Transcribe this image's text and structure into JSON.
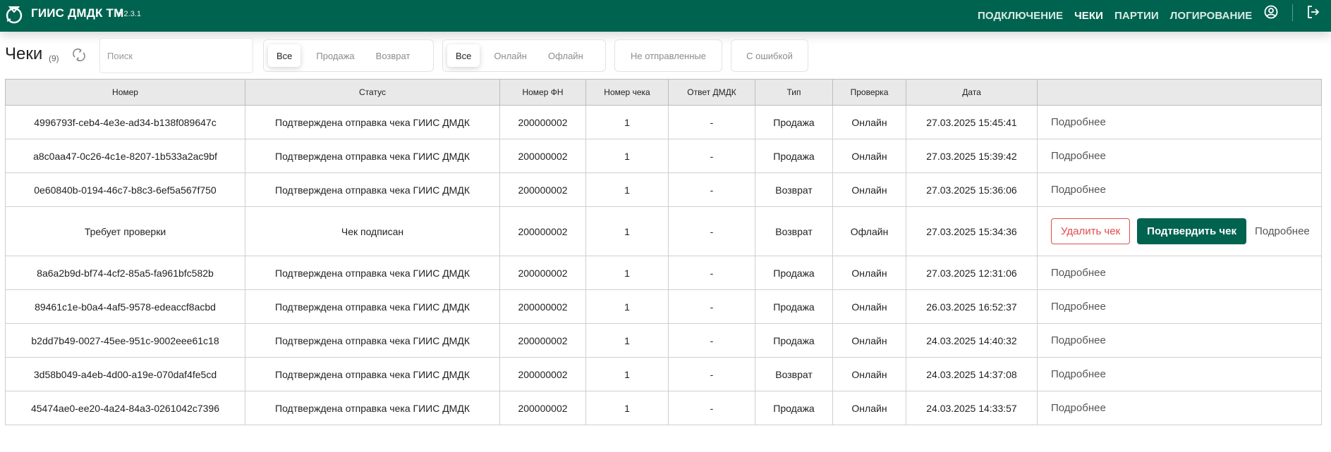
{
  "header": {
    "title": "ГИИС ДМДК ТМ",
    "version": "v 2.3.1",
    "nav": [
      {
        "label": "ПОДКЛЮЧЕНИЕ",
        "active": false
      },
      {
        "label": "ЧЕКИ",
        "active": true
      },
      {
        "label": "ПАРТИИ",
        "active": false
      },
      {
        "label": "ЛОГИРОВАНИЕ",
        "active": false
      }
    ],
    "icons": {
      "logo": "ring-logo-icon",
      "user": "user-circle-icon",
      "logout": "logout-icon"
    }
  },
  "toolbar": {
    "title": "Чеки",
    "count": "(9)",
    "search_placeholder": "Поиск",
    "type_filter": [
      "Все",
      "Продажа",
      "Возврат"
    ],
    "mode_filter": [
      "Все",
      "Онлайн",
      "Офлайн"
    ],
    "unsent_label": "Не отправленные",
    "error_label": "С ошибкой"
  },
  "table": {
    "columns": [
      "Номер",
      "Статус",
      "Номер ФН",
      "Номер чека",
      "Ответ ДМДК",
      "Тип",
      "Проверка",
      "Дата",
      ""
    ],
    "more_label": "Подробнее",
    "delete_label": "Удалить чек",
    "confirm_label": "Подтвердить чек",
    "rows": [
      {
        "id": "4996793f-ceb4-4e3e-ad34-b138f089647c",
        "status": "Подтверждена отправка чека ГИИС ДМДК",
        "fn": "200000002",
        "num": "1",
        "resp": "-",
        "type": "Продажа",
        "check": "Онлайн",
        "date": "27.03.2025 15:45:41"
      },
      {
        "id": "a8c0aa47-0c26-4c1e-8207-1b533a2ac9bf",
        "status": "Подтверждена отправка чека ГИИС ДМДК",
        "fn": "200000002",
        "num": "1",
        "resp": "-",
        "type": "Продажа",
        "check": "Онлайн",
        "date": "27.03.2025 15:39:42"
      },
      {
        "id": "0e60840b-0194-46c7-b8c3-6ef5a567f750",
        "status": "Подтверждена отправка чека ГИИС ДМДК",
        "fn": "200000002",
        "num": "1",
        "resp": "-",
        "type": "Возврат",
        "check": "Онлайн",
        "date": "27.03.2025 15:36:06"
      },
      {
        "id": "Требует проверки",
        "status": "Чек подписан",
        "fn": "200000002",
        "num": "1",
        "resp": "-",
        "type": "Возврат",
        "check": "Офлайн",
        "date": "27.03.2025 15:34:36"
      },
      {
        "id": "8a6a2b9d-bf74-4cf2-85a5-fa961bfc582b",
        "status": "Подтверждена отправка чека ГИИС ДМДК",
        "fn": "200000002",
        "num": "1",
        "resp": "-",
        "type": "Продажа",
        "check": "Онлайн",
        "date": "27.03.2025 12:31:06"
      },
      {
        "id": "89461c1e-b0a4-4af5-9578-edeaccf8acbd",
        "status": "Подтверждена отправка чека ГИИС ДМДК",
        "fn": "200000002",
        "num": "1",
        "resp": "-",
        "type": "Продажа",
        "check": "Онлайн",
        "date": "26.03.2025 16:52:37"
      },
      {
        "id": "b2dd7b49-0027-45ee-951c-9002eee61c18",
        "status": "Подтверждена отправка чека ГИИС ДМДК",
        "fn": "200000002",
        "num": "1",
        "resp": "-",
        "type": "Продажа",
        "check": "Онлайн",
        "date": "24.03.2025 14:40:32"
      },
      {
        "id": "3d58b049-a4eb-4d00-a19e-070daf4fe5cd",
        "status": "Подтверждена отправка чека ГИИС ДМДК",
        "fn": "200000002",
        "num": "1",
        "resp": "-",
        "type": "Возврат",
        "check": "Онлайн",
        "date": "24.03.2025 14:37:08"
      },
      {
        "id": "45474ae0-ee20-4a24-84a3-0261042c7396",
        "status": "Подтверждена отправка чека ГИИС ДМДК",
        "fn": "200000002",
        "num": "1",
        "resp": "-",
        "type": "Продажа",
        "check": "Онлайн",
        "date": "24.03.2025 14:33:57"
      }
    ]
  },
  "colors": {
    "brand": "#00634f",
    "sale": "#109087",
    "return": "#1a6fd2",
    "online": "#3fa315",
    "offline": "#e6354a",
    "warning": "#e24b4b"
  }
}
